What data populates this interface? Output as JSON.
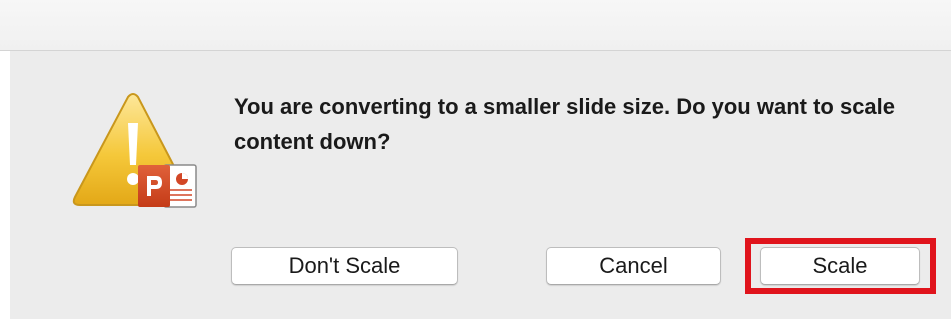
{
  "dialog": {
    "message": "You are converting to a smaller slide size. Do you want to scale content down?",
    "icon": "powerpoint-warning-icon",
    "buttons": {
      "dont_scale": "Don't Scale",
      "cancel": "Cancel",
      "scale": "Scale"
    },
    "highlight_color": "#e0141c"
  }
}
